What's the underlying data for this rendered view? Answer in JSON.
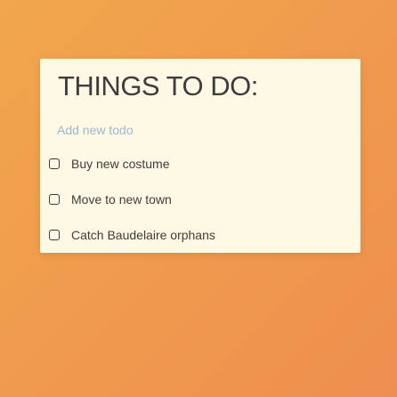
{
  "header": {
    "title": "THINGS TO DO:"
  },
  "new_todo": {
    "placeholder": "Add new todo",
    "value": ""
  },
  "todos": [
    {
      "label": "Buy new costume",
      "done": false
    },
    {
      "label": "Move to new town",
      "done": false
    },
    {
      "label": "Catch Baudelaire orphans",
      "done": false
    }
  ],
  "colors": {
    "background_start": "#f2a74c",
    "background_end": "#ee8f4f",
    "card": "#fef9e4",
    "text": "#3d3d3d",
    "placeholder": "#9fb6d4"
  },
  "icons": {
    "checkbox": "checkbox-empty-icon"
  }
}
